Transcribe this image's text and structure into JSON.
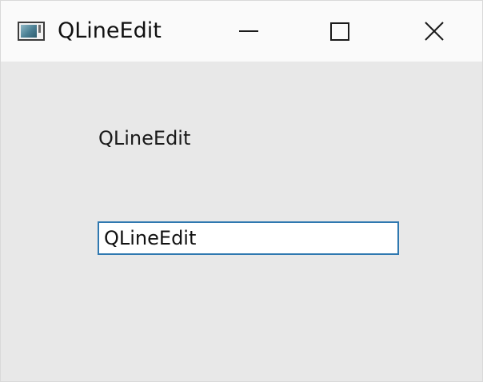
{
  "window": {
    "title": "QLineEdit",
    "controls": {
      "minimize": "minimize-icon",
      "maximize": "maximize-icon",
      "close": "close-icon"
    }
  },
  "content": {
    "label_text": "QLineEdit",
    "line_edit_value": "QLineEdit"
  },
  "colors": {
    "titlebar": "#fafafa",
    "client_background": "#e8e8e8",
    "focus_border": "#2f78b0"
  }
}
